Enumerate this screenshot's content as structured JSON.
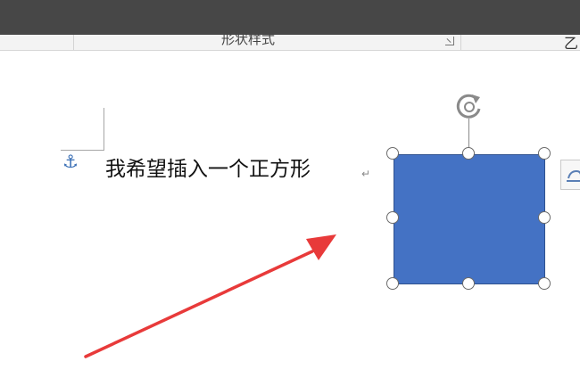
{
  "ribbon": {
    "group_label": "形状样式",
    "next_group_glyph": "乙"
  },
  "document": {
    "line_text": "我希望插入一个正方形",
    "paragraph_mark": "↵",
    "anchor_glyph": "⚓"
  },
  "shape": {
    "type": "rectangle",
    "fill": "#4472c4",
    "outline": "#2f528f",
    "selected": true
  },
  "annotation": {
    "arrow_color": "#e83a3a"
  },
  "icons": {
    "rotate": "rotate-handle-icon",
    "layout_options": "layout-options-icon",
    "launcher": "dialog-launcher-icon",
    "anchor": "anchor-icon"
  }
}
